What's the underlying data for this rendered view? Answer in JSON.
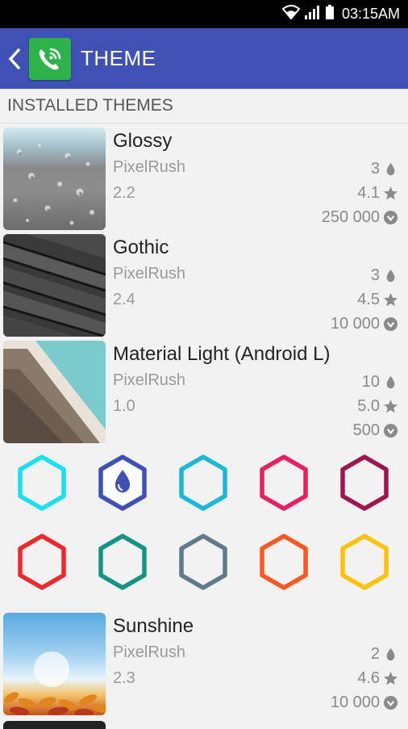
{
  "statusbar": {
    "time": "03:15AM"
  },
  "appbar": {
    "title": "THEME"
  },
  "section": {
    "title": "INSTALLED THEMES"
  },
  "themes": [
    {
      "name": "Glossy",
      "author": "PixelRush",
      "version": "2.2",
      "colors": "3",
      "rating": "4.1",
      "downloads": "250 000"
    },
    {
      "name": "Gothic",
      "author": "PixelRush",
      "version": "2.4",
      "colors": "3",
      "rating": "4.5",
      "downloads": "10 000"
    },
    {
      "name": "Material Light (Android L)",
      "author": "PixelRush",
      "version": "1.0",
      "colors": "10",
      "rating": "5.0",
      "downloads": "500"
    },
    {
      "name": "Sunshine",
      "author": "PixelRush",
      "version": "2.3",
      "colors": "2",
      "rating": "4.6",
      "downloads": "10 000"
    }
  ],
  "color_swatches": [
    {
      "color": "#18e0f0",
      "selected": false
    },
    {
      "color": "#3f51b5",
      "selected": true
    },
    {
      "color": "#1cb8d6",
      "selected": false
    },
    {
      "color": "#e91e63",
      "selected": false
    },
    {
      "color": "#a0154e",
      "selected": false
    },
    {
      "color": "#f0282e",
      "selected": false
    },
    {
      "color": "#149484",
      "selected": false
    },
    {
      "color": "#5e7b8c",
      "selected": false
    },
    {
      "color": "#ff5722",
      "selected": false
    },
    {
      "color": "#ffc107",
      "selected": false
    }
  ],
  "colors": {
    "appbar": "#3f51b5",
    "app_icon": "#2db34a"
  }
}
